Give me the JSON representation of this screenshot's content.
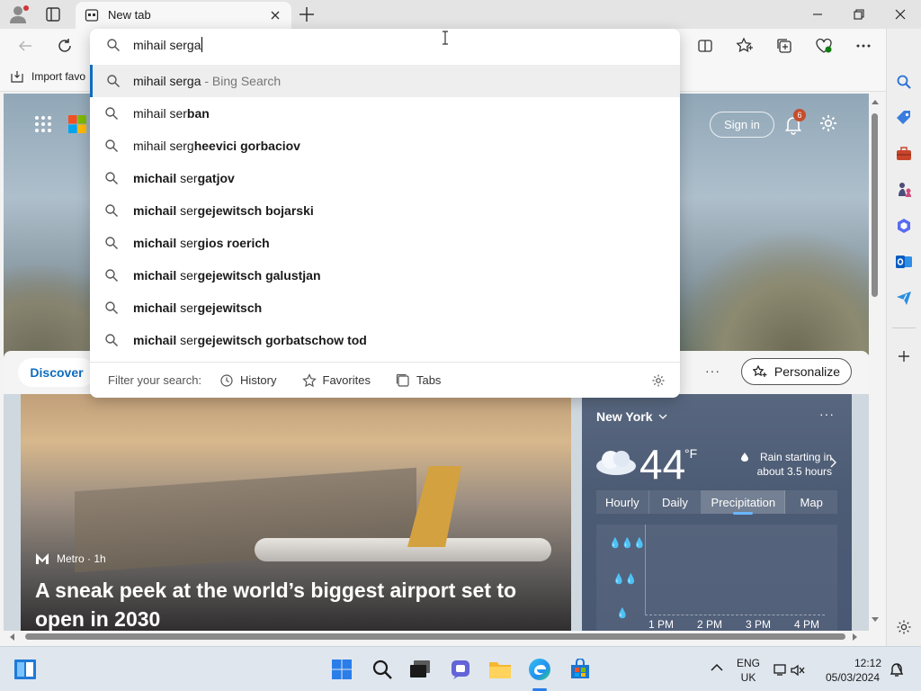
{
  "tab": {
    "title": "New tab"
  },
  "favorites_bar": {
    "import_label": "Import favo"
  },
  "address": {
    "typed": "mihail serga",
    "suggestions": [
      {
        "prefix": "mihail serga",
        "rest": "",
        "hint": " - Bing Search",
        "selected": true
      },
      {
        "prefix": "mihail ser",
        "rest": "ban",
        "hint": ""
      },
      {
        "prefix": "mihail serg",
        "rest": "heevici gorbaciov",
        "hint": ""
      },
      {
        "prefix": "michail",
        "mid": " ser",
        "rest": "gatjov",
        "hint": ""
      },
      {
        "prefix": "michail",
        "mid": " ser",
        "rest": "gejewitsch bojarski",
        "hint": ""
      },
      {
        "prefix": "michail",
        "mid": " ser",
        "rest": "gios roerich",
        "hint": ""
      },
      {
        "prefix": "michail",
        "mid": " ser",
        "rest": "gejewitsch galustjan",
        "hint": ""
      },
      {
        "prefix": "michail",
        "mid": " ser",
        "rest": "gejewitsch",
        "hint": ""
      },
      {
        "prefix": "michail",
        "mid": " ser",
        "rest": "gejewitsch gorbatschow tod",
        "hint": ""
      }
    ],
    "filter_label": "Filter your search:",
    "filters": [
      "History",
      "Favorites",
      "Tabs"
    ]
  },
  "page": {
    "sign_in": "Sign in",
    "notification_count": "6",
    "discover": "Discover",
    "more": "···",
    "personalize": "Personalize"
  },
  "news": {
    "source": "Metro · 1h",
    "headline": "A sneak peek at the world’s biggest airport set to open in 2030"
  },
  "weather": {
    "city": "New York",
    "more": "···",
    "temperature": "44",
    "unit": "°F",
    "rain_line1": "Rain starting in",
    "rain_line2": "about 3.5 hours",
    "tabs": [
      "Hourly",
      "Daily",
      "Precipitation",
      "Map"
    ],
    "active_tab": "Precipitation",
    "x_labels": [
      "1 PM",
      "2 PM",
      "3 PM",
      "4 PM"
    ]
  },
  "taskbar": {
    "lang_line1": "ENG",
    "lang_line2": "UK",
    "time": "12:12",
    "date": "05/03/2024"
  },
  "colors": {
    "accent": "#0f6cbd",
    "badge": "#c44e2d",
    "weather_bg": "#4d5c75"
  }
}
